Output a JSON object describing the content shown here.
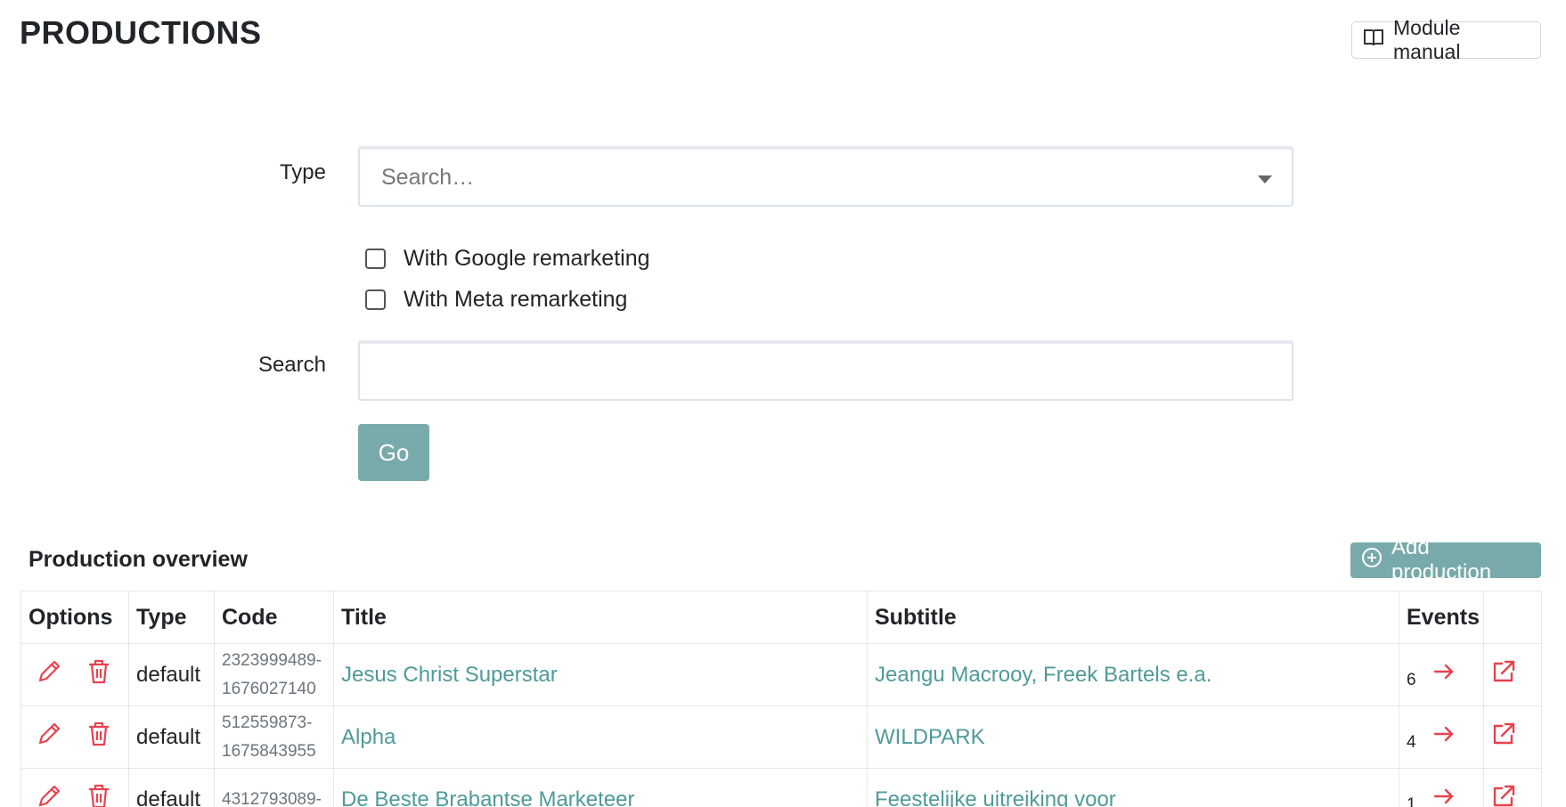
{
  "header": {
    "title": "PRODUCTIONS",
    "manual_button": "Module manual"
  },
  "filters": {
    "type_label": "Type",
    "type_placeholder": "Search…",
    "google_label": "With Google remarketing",
    "meta_label": "With Meta remarketing",
    "search_label": "Search",
    "search_value": "",
    "go_label": "Go"
  },
  "overview": {
    "title": "Production overview",
    "add_button": "Add production",
    "columns": [
      "Options",
      "Type",
      "Code",
      "Title",
      "Subtitle",
      "Events",
      ""
    ],
    "rows": [
      {
        "type": "default",
        "code_a": "2323999489-",
        "code_b": "1676027140",
        "title": "Jesus Christ Superstar",
        "subtitle": "Jeangu Macrooy, Freek Bartels e.a.",
        "events": "6"
      },
      {
        "type": "default",
        "code_a": "512559873-",
        "code_b": "1675843955",
        "title": "Alpha",
        "subtitle": "WILDPARK",
        "events": "4"
      },
      {
        "type": "default",
        "code_a": "4312793089-",
        "code_b": "",
        "title": "De Beste Brabantse Marketeer",
        "subtitle": "Feestelijke uitreiking voor",
        "events": "1"
      }
    ]
  },
  "colors": {
    "accent": "#79aaab",
    "link": "#4f9a9a",
    "danger": "#e8414e"
  },
  "icons": {
    "manual": "book-icon",
    "add": "plus-circle-icon",
    "edit": "pencil-icon",
    "delete": "trash-icon",
    "events": "arrow-right-icon",
    "open": "external-link-icon"
  }
}
